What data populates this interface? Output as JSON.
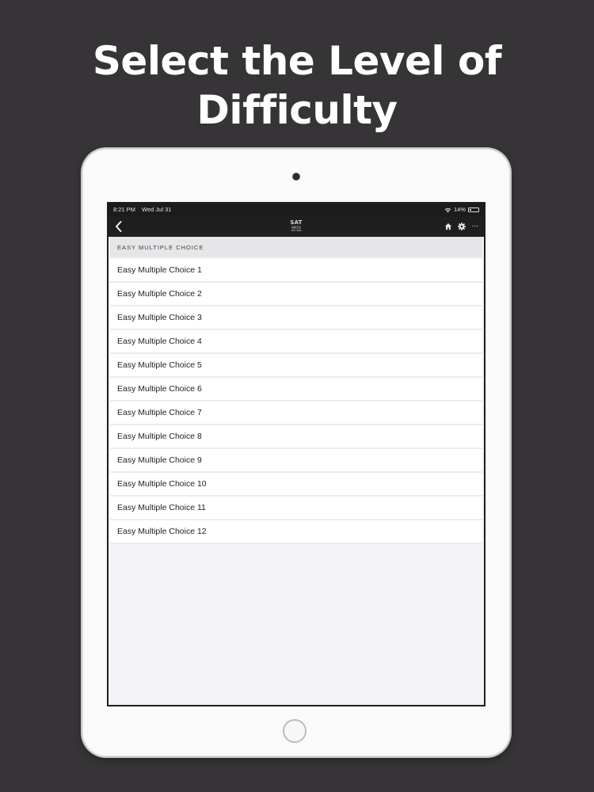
{
  "headline": {
    "line1": "Select the Level of",
    "line2": "Difficulty"
  },
  "status_bar": {
    "time": "8:21 PM",
    "date": "Wed Jul 31",
    "battery": "14%"
  },
  "nav_bar": {
    "logo_line1": "SAT",
    "logo_line2": "MATH",
    "logo_line3": "TEST PREP",
    "icons": [
      "back-icon",
      "home-icon",
      "gear-icon",
      "more-icon"
    ],
    "more_label": "···"
  },
  "list": {
    "section_header": "EASY MULTIPLE CHOICE",
    "items": [
      "Easy Multiple Choice 1",
      "Easy Multiple Choice 2",
      "Easy Multiple Choice 3",
      "Easy Multiple Choice 4",
      "Easy Multiple Choice 5",
      "Easy Multiple Choice 6",
      "Easy Multiple Choice 7",
      "Easy Multiple Choice 8",
      "Easy Multiple Choice 9",
      "Easy Multiple Choice 10",
      "Easy Multiple Choice 11",
      "Easy Multiple Choice 12"
    ]
  },
  "colors": {
    "background": "#363436",
    "navbar": "#1f1f1f",
    "list_bg": "#f3f3f5"
  }
}
